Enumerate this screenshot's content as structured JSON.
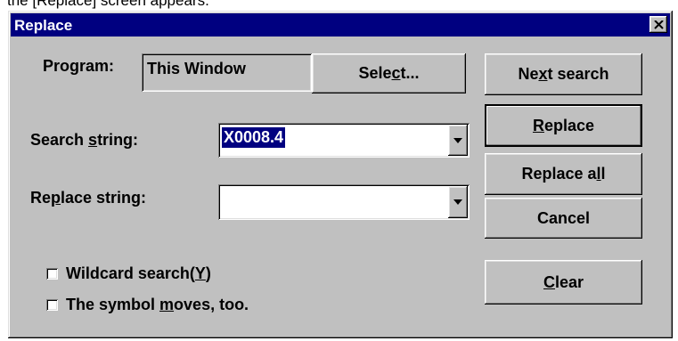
{
  "caption_fragment": "the [Replace] screen appears.",
  "window": {
    "title": "Replace",
    "close_glyph": "✕"
  },
  "program": {
    "label": "Program:",
    "value": "This Window",
    "select_button": {
      "pre": "Sele",
      "accel": "c",
      "post": "t..."
    }
  },
  "search": {
    "label_pre": "Search ",
    "label_accel": "s",
    "label_post": "tring:",
    "value": "X0008.4"
  },
  "replace_field": {
    "label_pre": "Re",
    "label_accel": "p",
    "label_post": "lace string:",
    "value": ""
  },
  "options": {
    "wildcard": {
      "pre": "Wildcard search(",
      "accel": "Y",
      "post": ")",
      "checked": false
    },
    "symbol_moves": {
      "pre": "The symbol ",
      "accel": "m",
      "post": "oves, too.",
      "checked": false
    }
  },
  "buttons": {
    "next_search": {
      "pre": "Ne",
      "accel": "x",
      "post": "t search"
    },
    "replace": {
      "pre": "",
      "accel": "R",
      "post": "eplace"
    },
    "replace_all": {
      "pre": "Replace a",
      "accel": "l",
      "post": "l"
    },
    "cancel": {
      "pre": "Cancel",
      "accel": "",
      "post": ""
    },
    "clear": {
      "pre": "",
      "accel": "C",
      "post": "lear"
    }
  },
  "icons": {
    "dropdown": "chevron-down-icon",
    "close": "close-icon"
  },
  "colors": {
    "titlebar": "#000080",
    "face": "#c0c0c0",
    "selection": "#000080"
  }
}
